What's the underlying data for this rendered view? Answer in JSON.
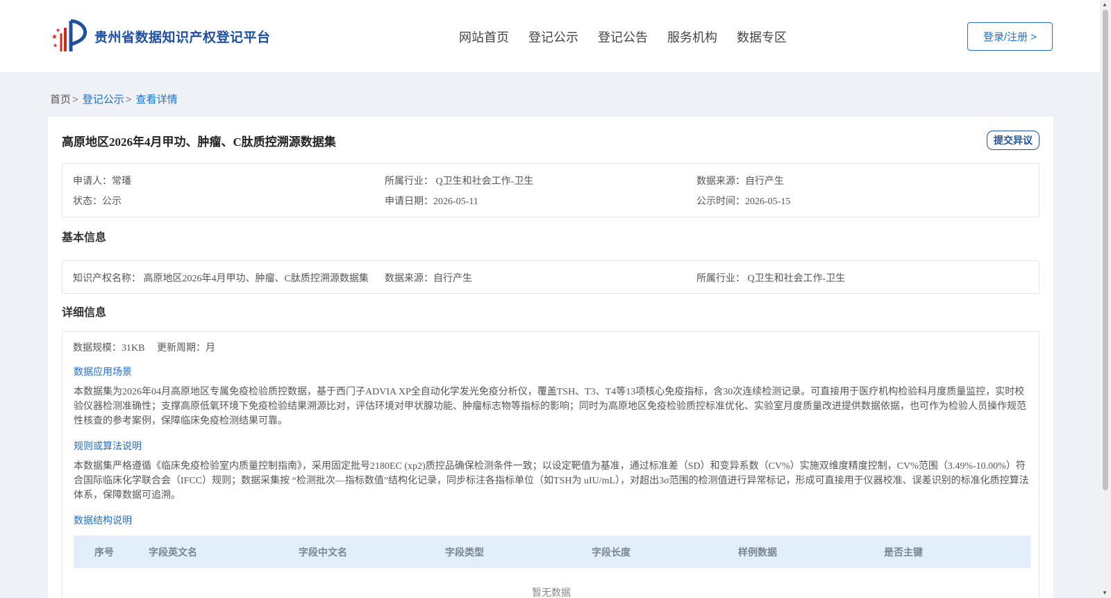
{
  "header": {
    "logo_text": "贵州省数据知识产权登记平台",
    "nav": [
      "网站首页",
      "登记公示",
      "登记公告",
      "服务机构",
      "数据专区"
    ],
    "login_label": "登录/注册 >"
  },
  "breadcrumb": {
    "home": "首页",
    "sep1": ">",
    "section": "登记公示",
    "sep2": ">",
    "current": "查看详情"
  },
  "record": {
    "title": "高原地区2026年4月甲功、肿瘤、C肽质控溯源数据集",
    "objection_label": "提交异议",
    "summary": {
      "applicant": "申请人：常璠",
      "industry": "所属行业： Q卫生和社会工作-卫生",
      "source": "数据来源：自行产生",
      "status": "状态：公示",
      "apply_date": "申请日期：2026-05-11",
      "publish_time": "公示时间：2026-05-15"
    }
  },
  "basic": {
    "section_title": "基本信息",
    "ip_name": "知识产权名称： 高原地区2026年4月甲功、肿瘤、C肽质控溯源数据集",
    "source": "数据来源：自行产生",
    "industry": "所属行业： Q卫生和社会工作-卫生"
  },
  "detail": {
    "section_title": "详细信息",
    "scale": "数据规模：31KB",
    "cycle": "更新周期：月",
    "scenario_title": "数据应用场景",
    "scenario_text": "本数据集为2026年04月高原地区专属免疫检验质控数据，基于西门子ADVIA XP全自动化学发光免疫分析仪，覆盖TSH、T3、T4等13项核心免疫指标，含30次连续检测记录。可直接用于医疗机构检验科月度质量监控，实时校验仪器检测准确性；支撑高原低氧环境下免疫检验结果溯源比对，评估环境对甲状腺功能、肿瘤标志物等指标的影响；同时为高原地区免疫检验质控标准优化、实验室月度质量改进提供数据依据，也可作为检验人员操作规范性核查的参考案例，保障临床免疫检测结果可靠。",
    "rule_title": "规则或算法说明",
    "rule_text": "本数据集严格遵循《临床免疫检验室内质量控制指南》，采用固定批号2180EC (xp2)质控品确保检测条件一致；以设定靶值为基准，通过标准差（SD）和变异系数（CV%）实施双维度精度控制，CV%范围（3.49%-10.00%）符合国际临床化学联合会（IFCC）规则；数据采集按 “检测批次—指标数值”结构化记录，同步标注各指标单位（如TSH为 uIU/mL），对超出3σ范围的检测值进行异常标记，形成可直接用于仪器校准、误差识别的标准化质控算法体系，保障数据可追溯。",
    "structure_title": "数据结构说明",
    "table_headers": [
      "序号",
      "字段英文名",
      "字段中文名",
      "字段类型",
      "字段长度",
      "样例数据",
      "是否主键"
    ],
    "empty_text": "暂无数据"
  }
}
